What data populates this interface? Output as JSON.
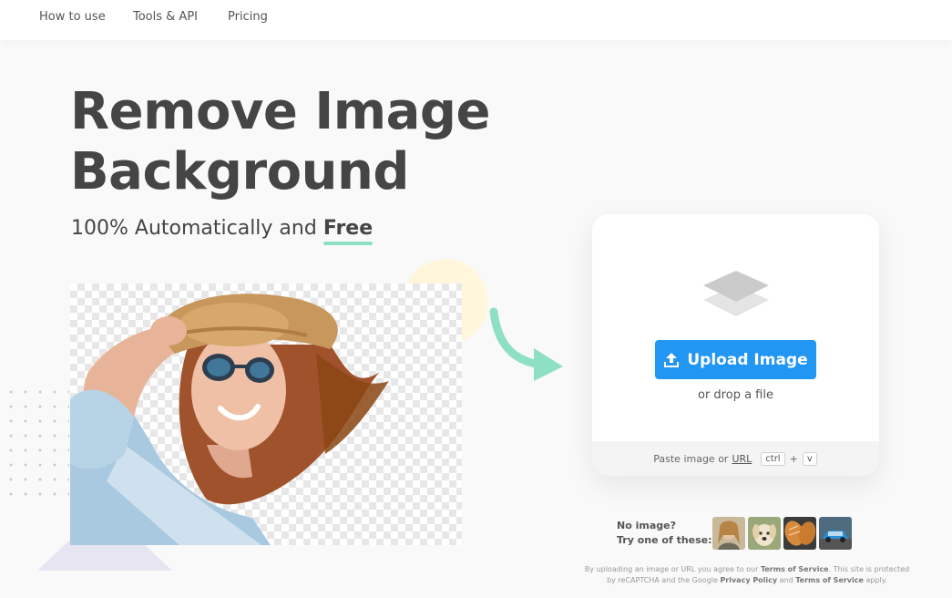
{
  "nav": {
    "items": [
      {
        "label": "How to use"
      },
      {
        "label": "Tools & API"
      },
      {
        "label": "Pricing"
      }
    ]
  },
  "hero": {
    "title_line1": "Remove Image",
    "title_line2": "Background",
    "subtitle_prefix": "100% Automatically and ",
    "subtitle_emphasis": "Free"
  },
  "upload": {
    "icon": "layers-icon",
    "button_label": "Upload Image",
    "button_icon": "upload-icon",
    "drop_text": "or drop a file",
    "paste_prefix": "Paste image or ",
    "paste_url": "URL",
    "key_ctrl": "ctrl",
    "key_plus": "+",
    "key_v": "v"
  },
  "samples": {
    "line1": "No image?",
    "line2": "Try one of these:",
    "items": [
      "woman-thumbnail",
      "dog-thumbnail",
      "bread-thumbnail",
      "car-thumbnail"
    ]
  },
  "legal": {
    "part1": "By uploading an image or URL you agree to our ",
    "tos1": "Terms of Service",
    "part2": ". This site is protected by reCAPTCHA and the Google ",
    "privacy": "Privacy Policy",
    "part3": " and ",
    "tos2": "Terms of Service",
    "part4": " apply."
  },
  "colors": {
    "accent_blue": "#2196f3",
    "underline_green": "#8ee0c5",
    "arrow_green": "#8ee0c5",
    "text_dark": "#454545"
  }
}
